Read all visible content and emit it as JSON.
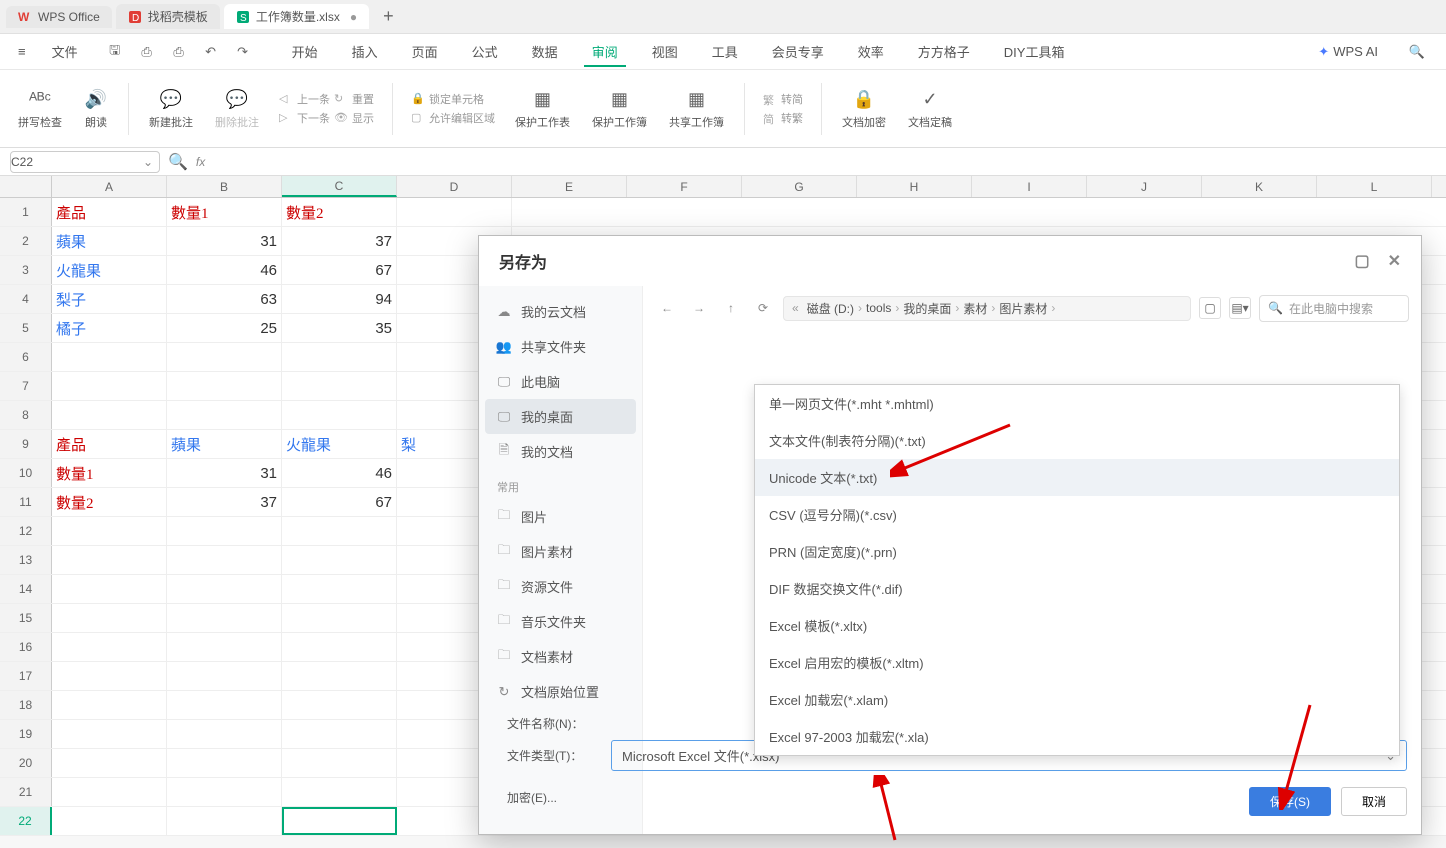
{
  "tabs": [
    {
      "label": "WPS Office",
      "icon": "w",
      "color": "#e03e36"
    },
    {
      "label": "找稻壳模板",
      "icon": "d",
      "color": "#e03e36"
    },
    {
      "label": "工作簿数量.xlsx",
      "icon": "s",
      "color": "#0a7",
      "active": true,
      "modified": true
    }
  ],
  "menu": {
    "file": "文件",
    "items": [
      "开始",
      "插入",
      "页面",
      "公式",
      "数据",
      "审阅",
      "视图",
      "工具",
      "会员专享",
      "效率",
      "方方格子",
      "DIY工具箱"
    ],
    "active_index": 5,
    "ai": "WPS AI"
  },
  "ribbon": {
    "spell": "拼写检查",
    "read": "朗读",
    "newcomment": "新建批注",
    "delcomment": "删除批注",
    "prev": "上一条",
    "repeat": "重置",
    "next": "下一条",
    "show": "显示",
    "lock": "锁定单元格",
    "allowedit": "允许编辑区域",
    "protectsheet": "保护工作表",
    "protectbook": "保护工作簿",
    "sharebook": "共享工作簿",
    "simpl": "转简",
    "trad": "转繁",
    "encrypt": "文档加密",
    "final": "文档定稿"
  },
  "formula": {
    "cell": "C22"
  },
  "columns": [
    "A",
    "B",
    "C",
    "D",
    "E",
    "F",
    "G",
    "H",
    "I",
    "J",
    "K",
    "L"
  ],
  "grid": {
    "r1": {
      "A": "產品",
      "B": "數量1",
      "C": "數量2"
    },
    "r2": {
      "A": "蘋果",
      "B": "31",
      "C": "37"
    },
    "r3": {
      "A": "火龍果",
      "B": "46",
      "C": "67"
    },
    "r4": {
      "A": "梨子",
      "B": "63",
      "C": "94"
    },
    "r5": {
      "A": "橘子",
      "B": "25",
      "C": "35"
    },
    "r9": {
      "A": "產品",
      "B": "蘋果",
      "C": "火龍果",
      "D": "梨"
    },
    "r10": {
      "A": "數量1",
      "B": "31",
      "C": "46"
    },
    "r11": {
      "A": "數量2",
      "B": "37",
      "C": "67"
    }
  },
  "dialog": {
    "title": "另存为",
    "sidebar": {
      "cloud": "我的云文档",
      "share": "共享文件夹",
      "pc": "此电脑",
      "desktop": "我的桌面",
      "docs": "我的文档",
      "common": "常用",
      "pic": "图片",
      "picmat": "图片素材",
      "res": "资源文件",
      "music": "音乐文件夹",
      "textmat": "文档素材",
      "origin": "文档原始位置"
    },
    "breadcrumb": [
      "磁盘 (D:)",
      "tools",
      "我的桌面",
      "素材",
      "图片素材"
    ],
    "search_placeholder": "在此电脑中搜索",
    "file_types": [
      "单一网页文件(*.mht *.mhtml)",
      "文本文件(制表符分隔)(*.txt)",
      "Unicode 文本(*.txt)",
      "CSV (逗号分隔)(*.csv)",
      "PRN (固定宽度)(*.prn)",
      "DIF 数据交换文件(*.dif)",
      "Excel 模板(*.xltx)",
      "Excel 启用宏的模板(*.xltm)",
      "Excel 加载宏(*.xlam)",
      "Excel 97-2003 加载宏(*.xla)"
    ],
    "filename_label": "文件名称(N)：",
    "filetype_label": "文件类型(T)：",
    "encrypt": "加密(E)...",
    "selected_type": "Microsoft Excel 文件(*.xlsx)",
    "save": "保存(S)",
    "cancel": "取消"
  }
}
